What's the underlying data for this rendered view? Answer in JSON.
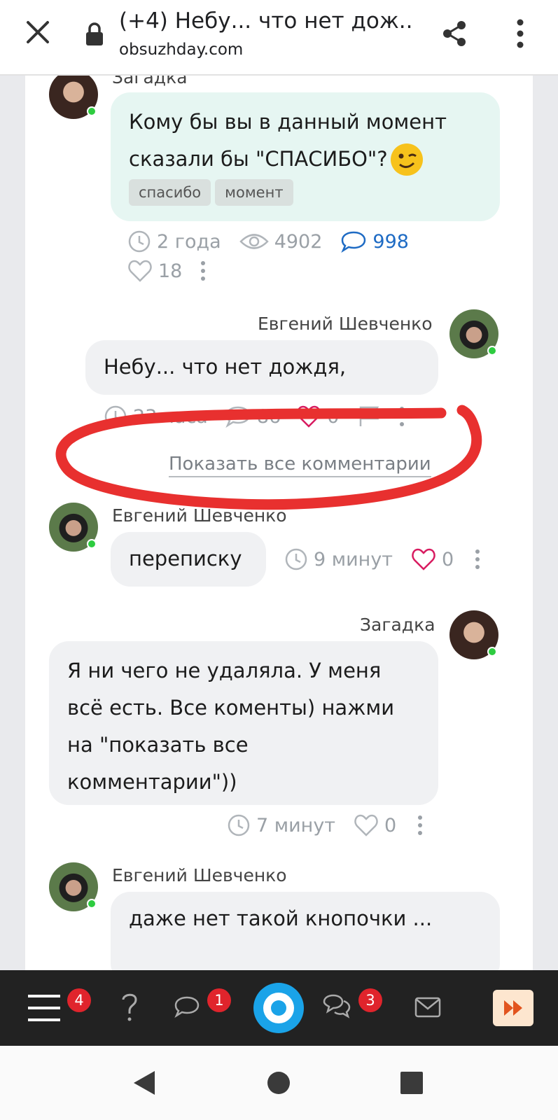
{
  "browser": {
    "title": "(+4) Небу... что нет дож...",
    "url": "obsuzhday.com"
  },
  "post": {
    "author": "Загадка",
    "text_line1": "Кому бы вы в данный момент",
    "text_line2": "сказали бы \"СПАСИБО\"?",
    "tags": [
      "спасибо",
      "момент"
    ],
    "time": "2 года",
    "views": "4902",
    "comments": "998",
    "likes": "18"
  },
  "comments": [
    {
      "author": "Евгений Шевченко",
      "text": "Небу... что нет дождя,",
      "time": "23 часа",
      "replies": "86",
      "likes": "0"
    },
    {
      "author": "Евгений Шевченко",
      "text": "переписку",
      "time": "9 минут",
      "likes": "0"
    },
    {
      "author": "Загадка",
      "lines": [
        "Я ни чего не удаляла. У меня",
        "всё есть. Все коменты) нажми",
        "на \"показать все",
        "комментарии\"))"
      ],
      "time": "7 минут",
      "likes": "0"
    },
    {
      "author": "Евгений Шевченко",
      "text": "даже нет такой кнопочки ..."
    }
  ],
  "show_all_label": "Показать все комментарии",
  "bottom_nav": {
    "menu_badge": "4",
    "chat_badge": "1",
    "discussions_badge": "3"
  },
  "colors": {
    "annotation": "#e8302f",
    "accent_blue": "#1e6bc4",
    "like_pink": "#d81b60"
  }
}
